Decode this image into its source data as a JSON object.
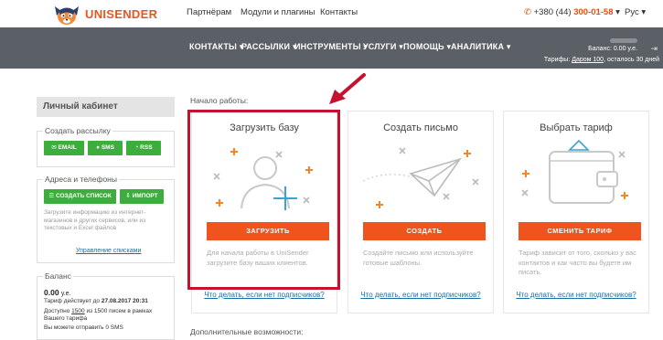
{
  "header": {
    "brand": "UNISENDER",
    "nav": [
      "Партнёрам",
      "Модули и плагины",
      "Контакты"
    ],
    "phone_prefix": "+380 (44) ",
    "phone_main": "300-01-58",
    "phone_caret": "▾",
    "lang": "Рус ▾"
  },
  "mainnav": {
    "items": [
      "КОНТАКТЫ ▾",
      "РАССЫЛКИ ▾",
      "ИНСТРУМЕНТЫ ▾",
      "УСЛУГИ ▾",
      "ПОМОЩЬ ▾",
      "АНАЛИТИКА ▾"
    ],
    "balance_label": "Баланс:",
    "balance_value": "0.00 у.е.",
    "tariff_prefix": "Тарифы:",
    "tariff_link": "Даром 100",
    "tariff_suffix": ", осталось 30 дней"
  },
  "sidebar": {
    "title": "Личный кабинет",
    "create_legend": "Создать рассылку",
    "btn_email": "EMAIL",
    "btn_sms": "SMS",
    "btn_rss": "RSS",
    "address_legend": "Адреса и телефоны",
    "btn_create_list": "СОЗДАТЬ СПИСОК",
    "btn_import": "ИМПОРТ",
    "hint1": "Загрузите информацию из интернет-",
    "hint2": "магазинов и других сервисов, или из",
    "hint3": "текстовых и Excel файлов",
    "manage_lists": "Управление списками",
    "balance_legend": "Баланс",
    "balance_amount": "0.00",
    "balance_unit": "у.е.",
    "tariff_line_prefix": "Тариф действует до ",
    "tariff_line_date": "27.08.2017 20:31",
    "avail_line_prefix": "Доступно ",
    "avail_line_num": "1500",
    "avail_line_suffix": " из 1500 писем в рамках",
    "avail_line2": "Вашего тарифа",
    "sms_line": "Вы можете отправить 0 SMS"
  },
  "main": {
    "start_label": "Начало работы:",
    "extra_label": "Дополнительные возможности:",
    "cards": [
      {
        "title": "Загрузить базу",
        "button": "ЗАГРУЗИТЬ",
        "text": "Для начала работы в UniSender загрузите базу ваших клиентов.",
        "link": "Что делать, если нет подписчиков?"
      },
      {
        "title": "Создать письмо",
        "button": "СОЗДАТЬ",
        "text": "Создайте письмо или используйте готовые шаблоны.",
        "link": "Что делать, если нет подписчиков?"
      },
      {
        "title": "Выбрать тариф",
        "button": "СМЕНИТЬ ТАРИФ",
        "text": "Тариф зависит от того, сколько у вас контактов и как часто вы будете им писать.",
        "link": "Что делать, если нет подписчиков?"
      }
    ]
  },
  "colors": {
    "accent": "#f0541e",
    "green": "#3dae3d",
    "nav_bg": "#5a6065",
    "highlight": "#c4122f",
    "link": "#1a6fa5"
  }
}
